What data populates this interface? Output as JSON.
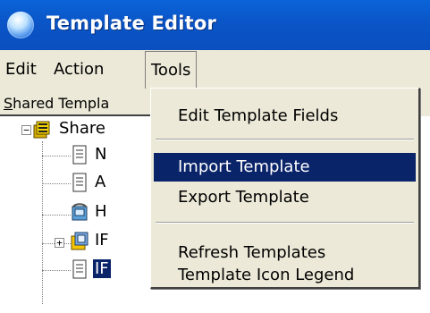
{
  "window": {
    "title": "Template Editor",
    "icon": "app-globe-icon"
  },
  "menubar": {
    "items": [
      "Edit",
      "Action",
      "Tools"
    ],
    "open_item": "Tools"
  },
  "panel": {
    "tab_label_first": "S",
    "tab_label_rest": "hared Templa"
  },
  "tree": {
    "nodes": [
      {
        "label": "Share",
        "icon": "server-icon",
        "expander": "−"
      },
      {
        "label": "N",
        "icon": "document-icon"
      },
      {
        "label": "A",
        "icon": "document-icon"
      },
      {
        "label": "H",
        "icon": "phone-icon"
      },
      {
        "label": "IF",
        "icon": "document-stack-icon",
        "expander": "+"
      },
      {
        "label": "IF",
        "icon": "document-icon",
        "selected": true
      }
    ]
  },
  "tools_menu": {
    "items": [
      "Edit Template Fields",
      "Import Template",
      "Export Template",
      "Refresh Templates",
      "Template Icon Legend"
    ],
    "highlighted": "Import Template"
  },
  "colors": {
    "titlebar": "#0a55c7",
    "menu_bg": "#ece9d8",
    "highlight": "#0a246a"
  }
}
